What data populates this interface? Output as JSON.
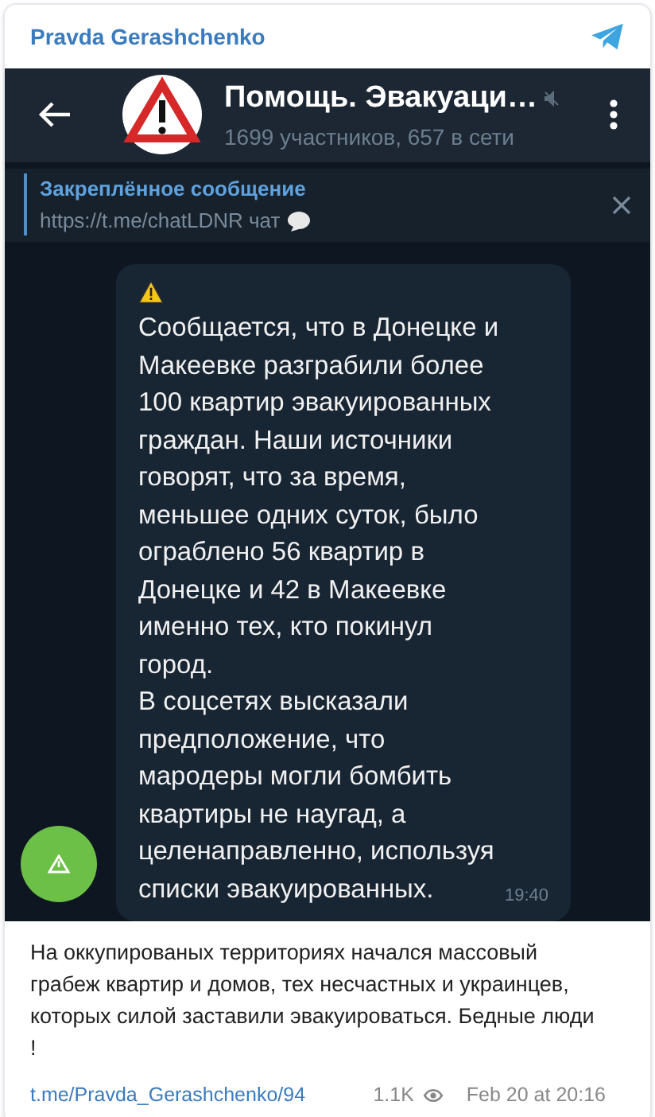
{
  "post": {
    "channel": "Pravda Gerashchenko"
  },
  "screenshot": {
    "chat_title": "Помощь. Эвакуаци…",
    "chat_subtitle": "1699 участников, 657 в сети",
    "muted": true,
    "pinned": {
      "title": "Закреплённое сообщение",
      "text": "https://t.me/chatLDNR чат"
    },
    "message": {
      "paragraphs": [
        "Сообщается, что в Донецке и\nМакеевке разграбили более\n100 квартир эвакуированных\nграждан. Наши источники\nговорят, что за время,\nменьшее одних суток, было\nограблено 56 квартир в\nДонецке и 42 в Макеевке\nименно тех, кто покинул\nгород.",
        "В соцсетях высказали\nпредположение, что\nмародеры могли бомбить\nквартиры не наугад, а\nцеленаправленно, используя\nсписки эвакуированных."
      ],
      "time": "19:40"
    }
  },
  "caption": "На оккупированых территориях начался массовый грабеж квартир и домов, тех несчастных и украинцев, которых силой заставили эвакуироваться. Бедные люди !",
  "footer": {
    "link": "t.me/Pravda_Gerashchenko/94",
    "views": "1.1K",
    "date": "Feb 20 at 20:16"
  }
}
